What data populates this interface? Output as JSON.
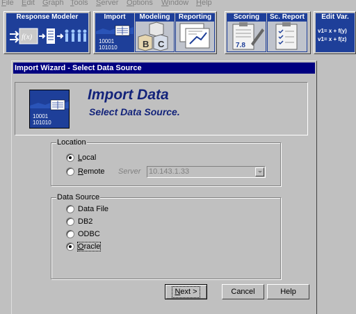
{
  "menu": [
    "File",
    "Edit",
    "Graph",
    "Tools",
    "Server",
    "Options",
    "Window",
    "Help"
  ],
  "toolbar": {
    "response_modeler": "Response Modeler",
    "import": "Import",
    "modeling": "Modeling",
    "reporting": "Reporting",
    "scoring": "Scoring",
    "sc_report": "Sc. Report",
    "edit_var": "Edit Var.",
    "fx": "f(x)",
    "bits_line1": "10001",
    "bits_line2": "101010",
    "block_b": "B",
    "block_c": "C",
    "score_value": "7.8",
    "eq1": "v1= x + f(y)",
    "eq2": "v1= x + f(z)"
  },
  "dialog": {
    "title": "Import Wizard - Select Data Source",
    "header_title": "Import Data",
    "header_subtitle": "Select Data Source.",
    "location": {
      "label": "Location",
      "local": "Local",
      "remote": "Remote",
      "selected": "local",
      "server_label": "Server",
      "server_value": "10.143.1.33"
    },
    "data_source": {
      "label": "Data Source",
      "options": [
        "Data File",
        "DB2",
        "ODBC",
        "Oracle"
      ],
      "selected": "Oracle"
    },
    "buttons": {
      "next": "Next >",
      "cancel": "Cancel",
      "help": "Help"
    }
  },
  "colors": {
    "title_bar": "#000080",
    "toolbar_blue": "#1e3f99",
    "header_text": "#13237a",
    "face": "#c0c0c0"
  }
}
